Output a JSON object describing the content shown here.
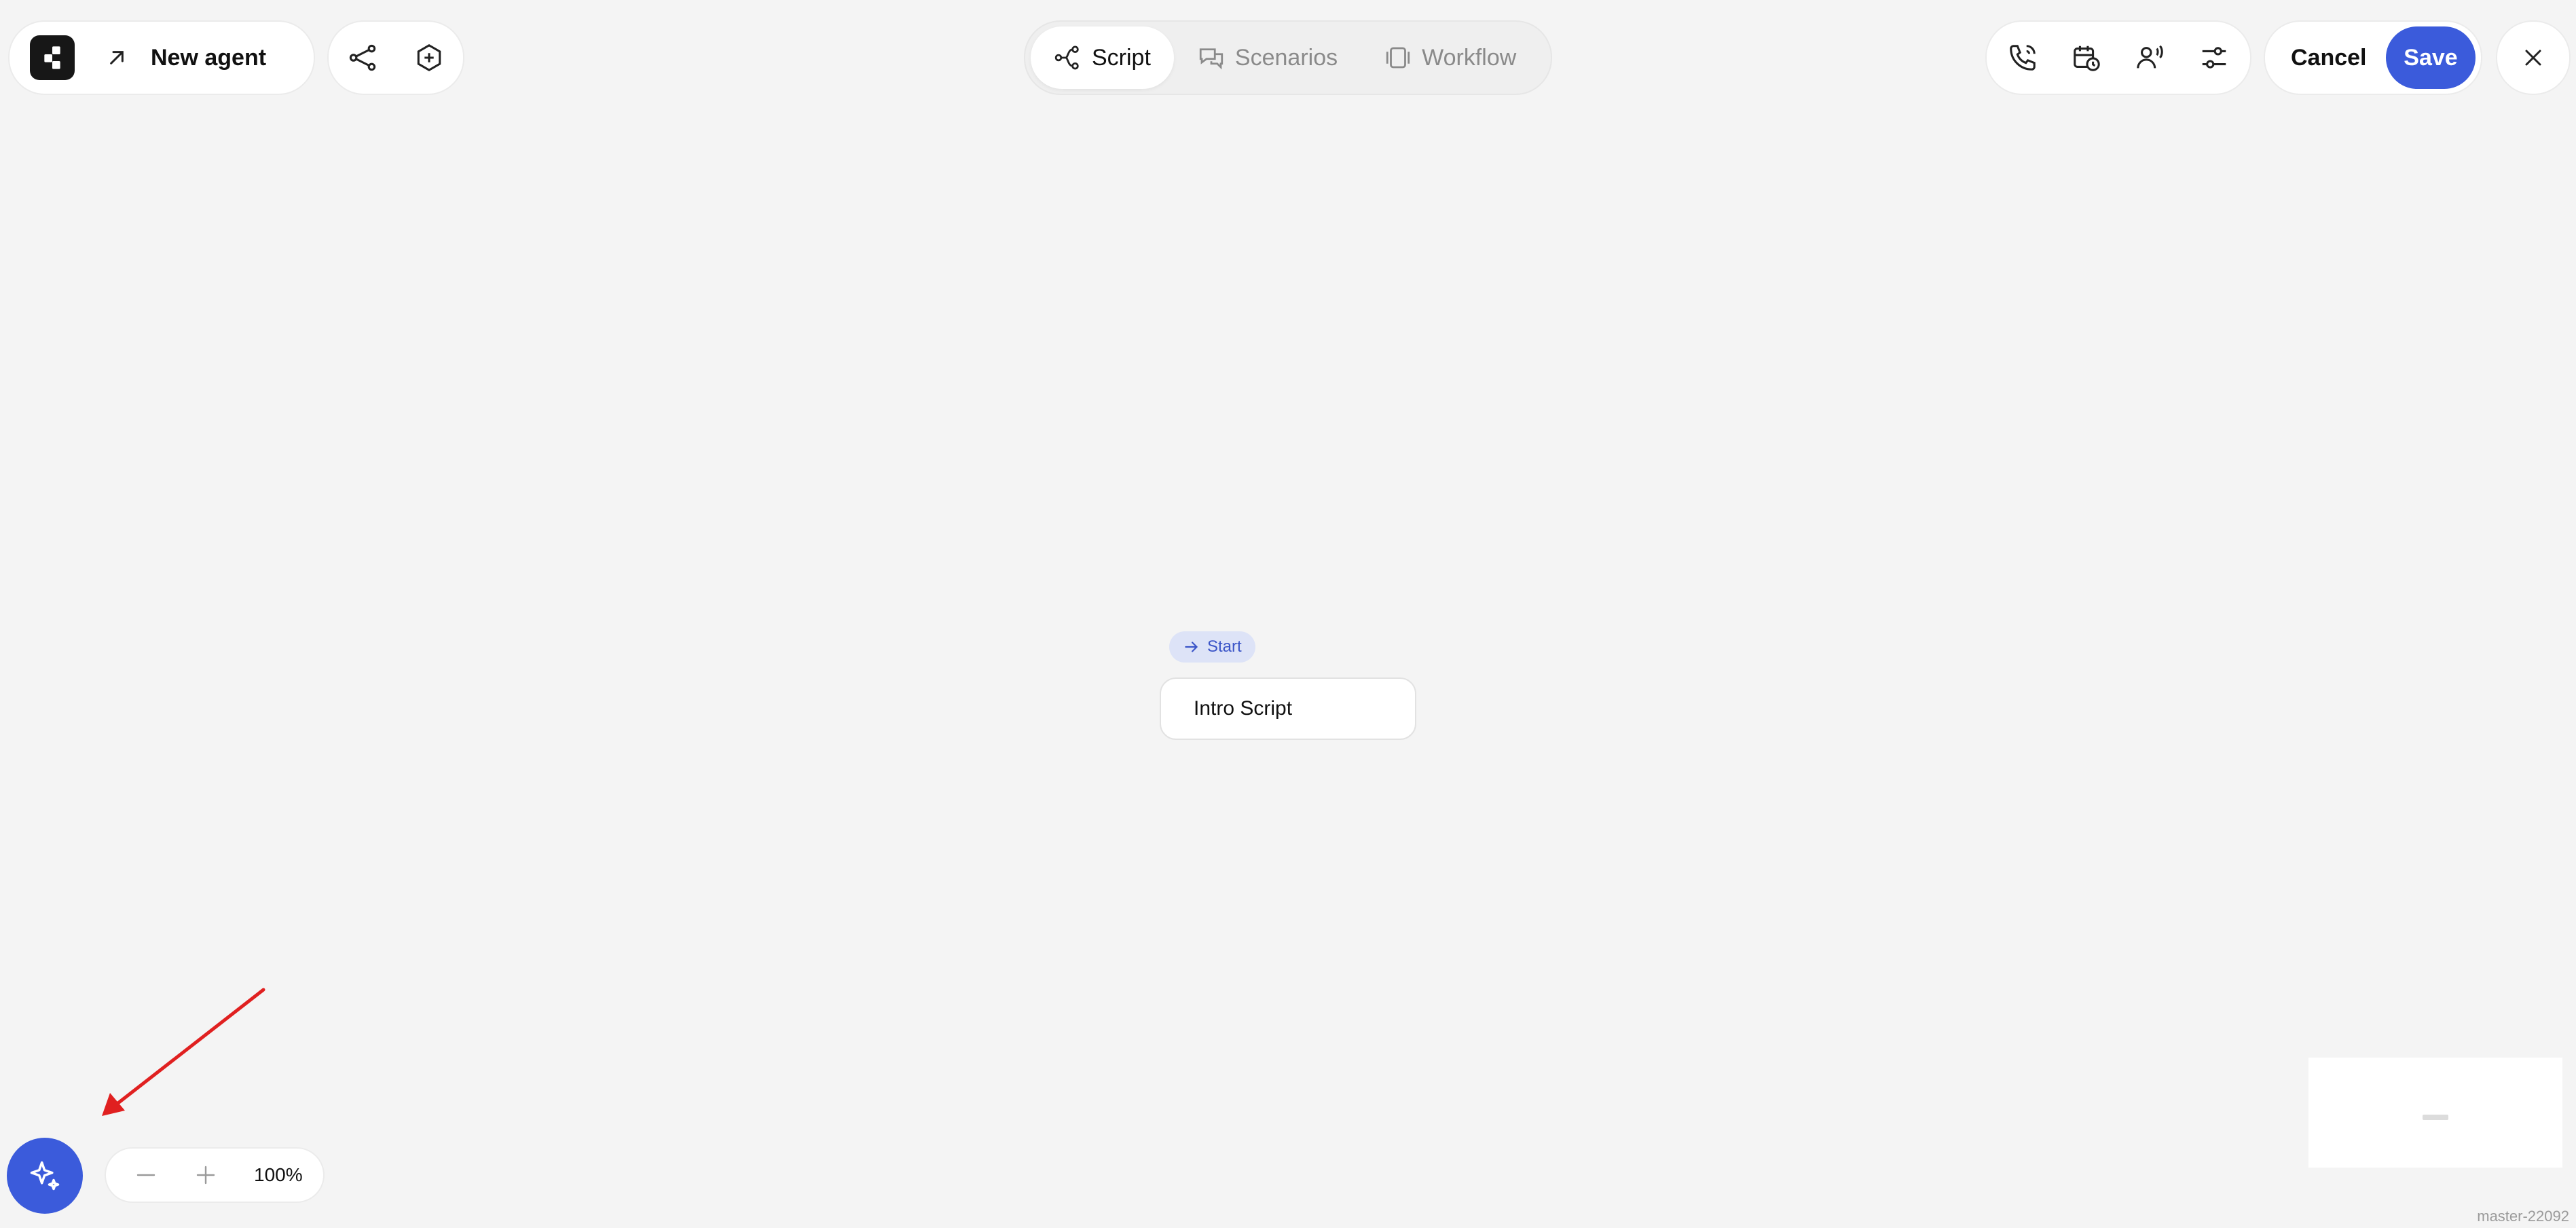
{
  "header": {
    "agent_name": "New agent",
    "tabs": [
      {
        "label": "Script",
        "active": true,
        "icon": "flow-icon"
      },
      {
        "label": "Scenarios",
        "active": false,
        "icon": "chat-bubbles-icon"
      },
      {
        "label": "Workflow",
        "active": false,
        "icon": "workflow-icon"
      }
    ],
    "left_tools": [
      "branch-icon",
      "hexagon-plus-icon"
    ],
    "right_tools": [
      "phone-call-icon",
      "calendar-clock-icon",
      "voice-user-icon",
      "sliders-icon"
    ],
    "cancel_label": "Cancel",
    "save_label": "Save"
  },
  "canvas": {
    "start_label": "Start",
    "node_label": "Intro Script"
  },
  "zoom": {
    "level": "100%"
  },
  "footer": {
    "version": "master-22092"
  },
  "colors": {
    "accent": "#3b5bdb",
    "background": "#f4f4f4",
    "start_badge_bg": "#dde3f7",
    "annotation": "#e02020"
  }
}
